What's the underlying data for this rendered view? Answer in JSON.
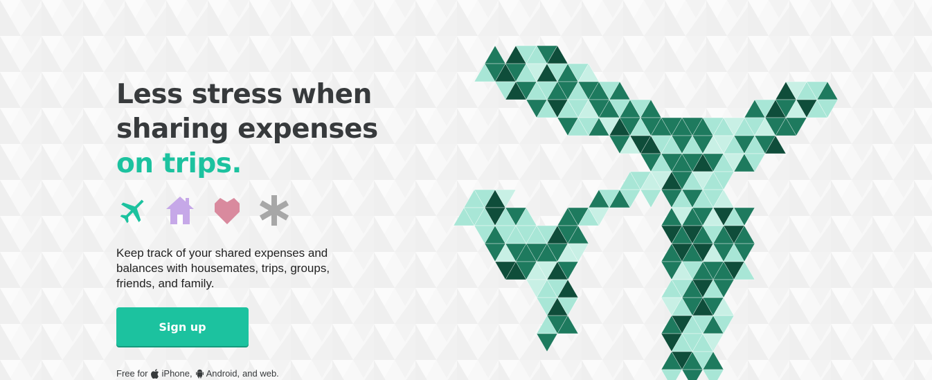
{
  "hero": {
    "headline_line1": "Less stress when",
    "headline_line2": "sharing expenses",
    "headline_accent": "on trips.",
    "description": "Keep track of your shared expenses and balances with housemates, trips, groups, friends, and family."
  },
  "categories": [
    {
      "icon": "plane-icon",
      "color": "#1cc29f"
    },
    {
      "icon": "house-icon",
      "color": "#c6a8e8"
    },
    {
      "icon": "heart-icon",
      "color": "#d98a9e"
    },
    {
      "icon": "asterisk-icon",
      "color": "#a7a7a7"
    }
  ],
  "cta": {
    "signup_label": "Sign up"
  },
  "platforms": {
    "prefix": "Free for",
    "iphone": "iPhone,",
    "android": "Android,",
    "suffix": "and web."
  },
  "colors": {
    "accent": "#1cc29f",
    "headline": "#373a3c",
    "plane_light": "#a8e6d6",
    "plane_mid": "#1e7a5e",
    "plane_dark": "#0f4d3a"
  }
}
